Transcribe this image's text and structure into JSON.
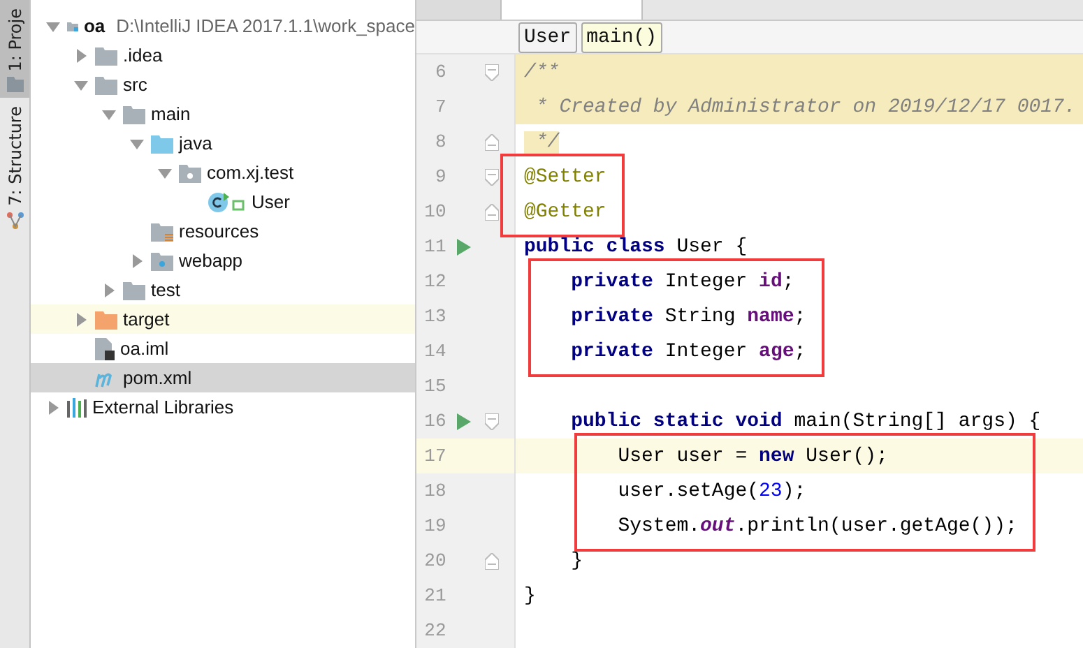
{
  "tool_strip": [
    {
      "label": "1: Proje",
      "kind": "folder",
      "selected": true
    },
    {
      "label": "7: Structure",
      "kind": "structure",
      "selected": false
    }
  ],
  "project_tree": [
    {
      "name": "oa",
      "path": "D:\\IntelliJ IDEA 2017.1.1\\work_space",
      "kind": "module",
      "expanded": true,
      "bold": true,
      "children": [
        {
          "name": ".idea",
          "kind": "folder",
          "expanded": false
        },
        {
          "name": "src",
          "kind": "folder",
          "expanded": true,
          "children": [
            {
              "name": "main",
              "kind": "folder",
              "expanded": true,
              "children": [
                {
                  "name": "java",
                  "kind": "source",
                  "expanded": true,
                  "children": [
                    {
                      "name": "com.xj.test",
                      "kind": "package",
                      "expanded": true,
                      "children": [
                        {
                          "name": "User",
                          "kind": "class"
                        }
                      ]
                    }
                  ]
                },
                {
                  "name": "resources",
                  "kind": "resources"
                },
                {
                  "name": "webapp",
                  "kind": "web",
                  "expanded": false
                }
              ]
            },
            {
              "name": "test",
              "kind": "folder",
              "expanded": false
            }
          ]
        },
        {
          "name": "target",
          "kind": "excluded",
          "expanded": false
        },
        {
          "name": "oa.iml",
          "kind": "file"
        },
        {
          "name": "pom.xml",
          "kind": "maven",
          "selected": true
        }
      ]
    },
    {
      "name": "External Libraries",
      "kind": "libraries",
      "expanded": false
    }
  ],
  "breadcrumbs": [
    {
      "label": "User",
      "selected": false
    },
    {
      "label": "main()",
      "selected": true
    }
  ],
  "code_lines": [
    {
      "number": "6",
      "fold_start": true,
      "doc_line": true,
      "tokens": [
        {
          "kind": "comment",
          "text": "/**"
        }
      ]
    },
    {
      "number": "7",
      "doc_line": true,
      "tokens": [
        {
          "kind": "comment",
          "text": " * Created by Administrator on 2019/12/17 0017."
        }
      ]
    },
    {
      "number": "8",
      "fold_end": true,
      "tokens": [
        {
          "kind": "doc",
          "text": " */"
        }
      ]
    },
    {
      "number": "9",
      "fold_start": true,
      "boxed": true,
      "tokens": [
        {
          "kind": "annotation",
          "text": "@Setter"
        }
      ]
    },
    {
      "number": "10",
      "fold_end": true,
      "boxed": true,
      "tokens": [
        {
          "kind": "annotation",
          "text": "@Getter"
        }
      ]
    },
    {
      "number": "11",
      "run_marker": true,
      "tokens": [
        {
          "kind": "keyword",
          "text": "public class"
        },
        {
          "kind": "plain",
          "text": " User {"
        }
      ]
    },
    {
      "number": "12",
      "boxed": true,
      "tokens": [
        {
          "kind": "keyword",
          "text": "    private"
        },
        {
          "kind": "plain",
          "text": " Integer "
        },
        {
          "kind": "field",
          "text": "id"
        },
        {
          "kind": "plain",
          "text": ";"
        }
      ]
    },
    {
      "number": "13",
      "boxed": true,
      "tokens": [
        {
          "kind": "keyword",
          "text": "    private"
        },
        {
          "kind": "plain",
          "text": " String "
        },
        {
          "kind": "field",
          "text": "name"
        },
        {
          "kind": "plain",
          "text": ";"
        }
      ]
    },
    {
      "number": "14",
      "boxed": true,
      "tokens": [
        {
          "kind": "keyword",
          "text": "    private"
        },
        {
          "kind": "plain",
          "text": " Integer "
        },
        {
          "kind": "field",
          "text": "age"
        },
        {
          "kind": "plain",
          "text": ";"
        }
      ]
    },
    {
      "number": "15"
    },
    {
      "number": "16",
      "run_marker": true,
      "fold_start": true,
      "tokens": [
        {
          "kind": "keyword",
          "text": "    public static void"
        },
        {
          "kind": "plain",
          "text": " main(String[] args) {"
        }
      ]
    },
    {
      "number": "17",
      "current": true,
      "boxed": true,
      "tokens": [
        {
          "kind": "plain",
          "text": "        User user = "
        },
        {
          "kind": "keyword",
          "text": "new"
        },
        {
          "kind": "plain",
          "text": " User();"
        }
      ]
    },
    {
      "number": "18",
      "boxed": true,
      "tokens": [
        {
          "kind": "plain",
          "text": "        user.setAge("
        },
        {
          "kind": "number",
          "text": "23"
        },
        {
          "kind": "plain",
          "text": ");"
        }
      ]
    },
    {
      "number": "19",
      "boxed": true,
      "tokens": [
        {
          "kind": "plain",
          "text": "        System."
        },
        {
          "kind": "static",
          "text": "out"
        },
        {
          "kind": "plain",
          "text": ".println(user.getAge());"
        }
      ]
    },
    {
      "number": "20",
      "fold_end": true,
      "tokens": [
        {
          "kind": "plain",
          "text": "    }"
        }
      ]
    },
    {
      "number": "21",
      "tokens": [
        {
          "kind": "plain",
          "text": "}"
        }
      ]
    },
    {
      "number": "22"
    }
  ]
}
